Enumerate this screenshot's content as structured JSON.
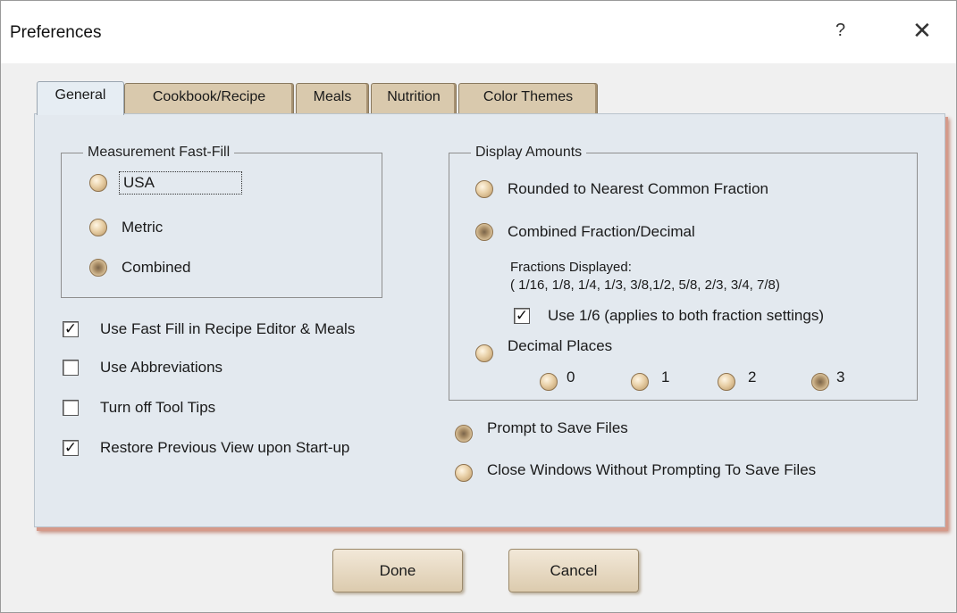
{
  "window": {
    "title": "Preferences",
    "help_glyph": "?",
    "close_glyph": "✕"
  },
  "tabs": [
    "General",
    "Cookbook/Recipe",
    "Meals",
    "Nutrition",
    "Color Themes"
  ],
  "measurement": {
    "legend": "Measurement Fast-Fill",
    "options": [
      "USA",
      "Metric",
      "Combined"
    ],
    "selected": "Combined"
  },
  "checkboxes": [
    {
      "label": "Use Fast Fill in Recipe Editor & Meals",
      "checked": true
    },
    {
      "label": "Use Abbreviations",
      "checked": false
    },
    {
      "label": "Turn off Tool Tips",
      "checked": false
    },
    {
      "label": "Restore Previous View upon Start-up",
      "checked": true
    }
  ],
  "display_amounts": {
    "legend": "Display Amounts",
    "options": [
      "Rounded to Nearest Common Fraction",
      "Combined Fraction/Decimal",
      "Decimal Places"
    ],
    "selected": "Combined Fraction/Decimal",
    "fractions_label": "Fractions Displayed:",
    "fractions_list": "( 1/16, 1/8, 1/4, 1/3, 3/8,1/2, 5/8, 2/3, 3/4, 7/8)",
    "use_sixth": {
      "label": "Use 1/6 (applies to both fraction settings)",
      "checked": true
    },
    "decimal_places": [
      "0",
      "1",
      "2",
      "3"
    ],
    "decimal_selected": "3"
  },
  "save_prompt": {
    "options": [
      "Prompt to Save Files",
      "Close Windows Without Prompting To Save Files"
    ],
    "selected": "Prompt to Save Files"
  },
  "buttons": {
    "done": "Done",
    "cancel": "Cancel"
  },
  "colors": {
    "panel": "#e3e9ef",
    "tab": "#d9c9ad",
    "radio": "#e8cfa6",
    "shadow": "#d59a8a"
  }
}
